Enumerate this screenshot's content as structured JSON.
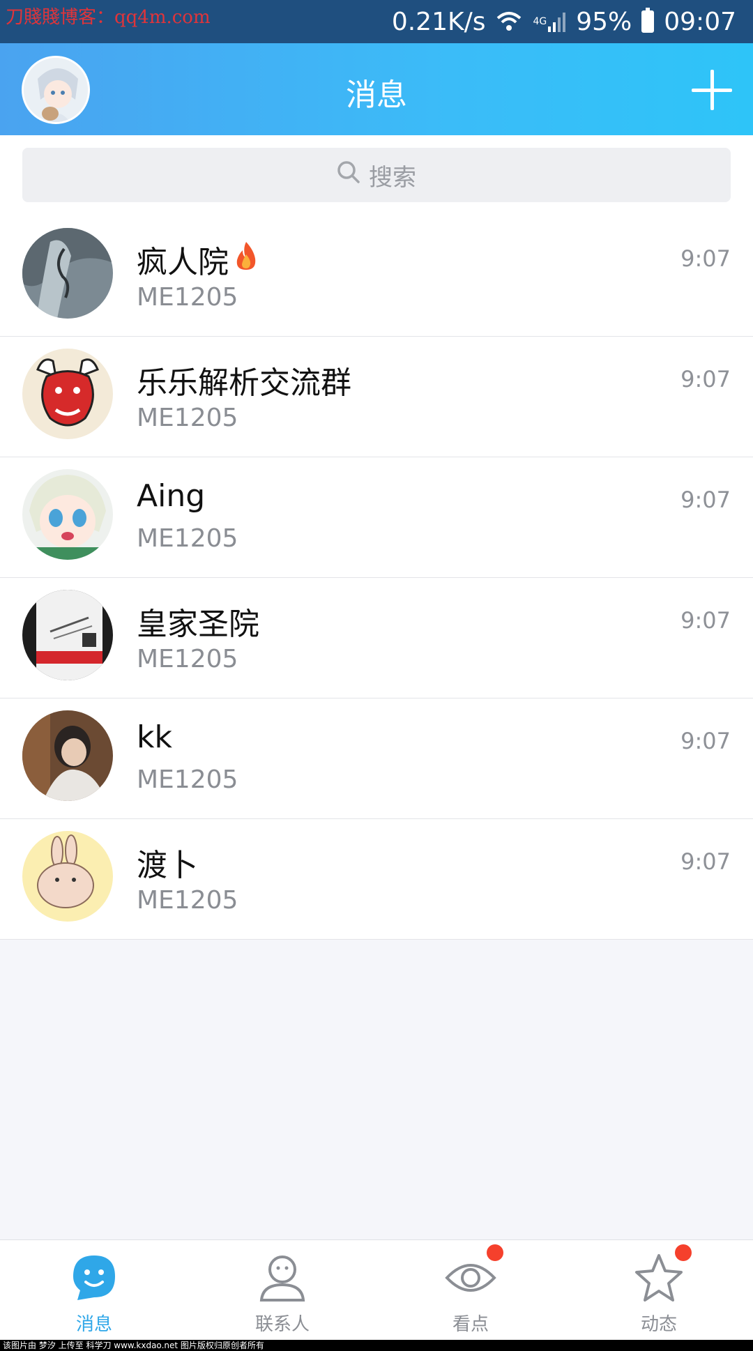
{
  "status_bar": {
    "watermark": "刀賤賤博客：qq4m.com",
    "speed": "0.21K/s",
    "network": "4G",
    "battery": "95%",
    "time": "09:07"
  },
  "header": {
    "title": "消息"
  },
  "search": {
    "placeholder": "搜索"
  },
  "chats": [
    {
      "name": "疯人院",
      "preview": "ME1205",
      "time": "9:07",
      "badge_icon": "fire-icon"
    },
    {
      "name": "乐乐解析交流群",
      "preview": "ME1205",
      "time": "9:07"
    },
    {
      "name": "Aing",
      "preview": "ME1205",
      "time": "9:07"
    },
    {
      "name": "皇家圣院",
      "preview": "ME1205",
      "time": "9:07"
    },
    {
      "name": "kk",
      "preview": "ME1205",
      "time": "9:07"
    },
    {
      "name": "渡卜",
      "preview": "ME1205",
      "time": "9:07"
    }
  ],
  "nav": {
    "items": [
      {
        "label": "消息",
        "icon": "message-icon",
        "active": true
      },
      {
        "label": "联系人",
        "icon": "contacts-icon"
      },
      {
        "label": "看点",
        "icon": "eye-icon",
        "has_dot": true
      },
      {
        "label": "动态",
        "icon": "star-icon",
        "has_dot": true
      }
    ]
  },
  "footer": {
    "text": "该图片由 梦汐 上传至 科学刀 www.kxdao.net 图片版权归原创者所有"
  },
  "colors": {
    "accent": "#2fa7e8",
    "header_start": "#4aa3f0",
    "header_end": "#2ec4f8",
    "status_bar": "#1f4f7f",
    "badge_dot": "#f5402c"
  }
}
